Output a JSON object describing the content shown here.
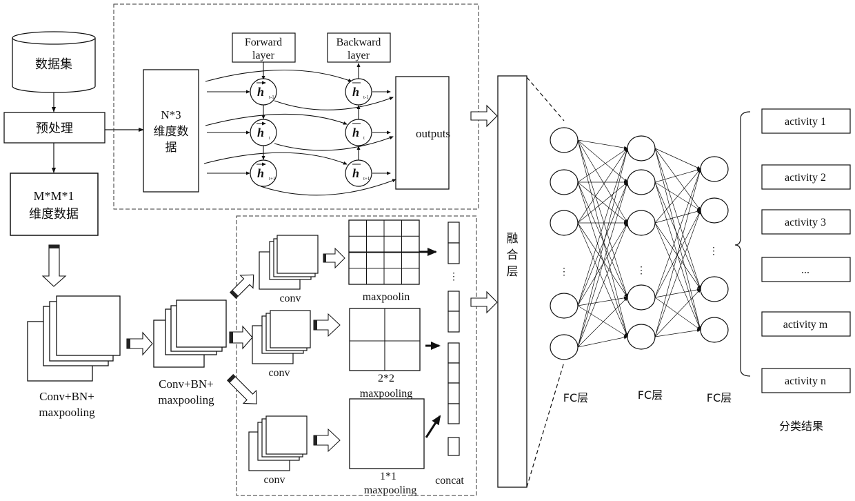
{
  "diagram": {
    "title": "",
    "colors": {
      "stroke": "#111111",
      "background": "#ffffff",
      "dashed": "#333333"
    },
    "left_pipeline": {
      "dataset": "数据集",
      "preprocess": "预处理",
      "mm_data_line1": "M*M*1",
      "mm_data_line2": "维度数据",
      "stage1_line1": "Conv+BN+",
      "stage1_line2": "maxpooling",
      "stage2_line1": "Conv+BN+",
      "stage2_line2": "maxpooling"
    },
    "bilstm_block": {
      "input_line1": "N*3",
      "input_line2": "维度数",
      "input_line3": "据",
      "forward_line1": "Forward",
      "forward_line2": "layer",
      "backward_line1": "Backward",
      "backward_line2": "layer",
      "outputs": "outputs",
      "forward_nodes": [
        {
          "symbol": "h",
          "sub": "t-1"
        },
        {
          "symbol": "h",
          "sub": "t"
        },
        {
          "symbol": "h",
          "sub": "t+1"
        }
      ],
      "backward_nodes": [
        {
          "symbol": "h",
          "sub": "t-1"
        },
        {
          "symbol": "h",
          "sub": "t"
        },
        {
          "symbol": "h",
          "sub": "t+1"
        }
      ]
    },
    "spp_block": {
      "conv_labels": [
        "conv",
        "conv",
        "conv"
      ],
      "pool_labels": [
        "maxpoolin",
        "2*2\nmaxpooling",
        "1*1\nmaxpooling"
      ],
      "pool4_label": "maxpoolin",
      "pool2_line1": "2*2",
      "pool2_line2": "maxpooling",
      "pool1_line1": "1*1",
      "pool1_line2": "maxpooling",
      "concat": "concat",
      "vertical_dots": "⋮"
    },
    "fusion": {
      "label_chars": [
        "融",
        "合",
        "层"
      ]
    },
    "fc_layers": {
      "labels": [
        "FC层",
        "FC层",
        "FC层"
      ],
      "ellipsis": "⋮"
    },
    "outputs": {
      "activities": [
        "activity 1",
        "activity 2",
        "activity 3",
        "...",
        "activity m",
        "activity n"
      ],
      "caption": "分类结果"
    }
  }
}
